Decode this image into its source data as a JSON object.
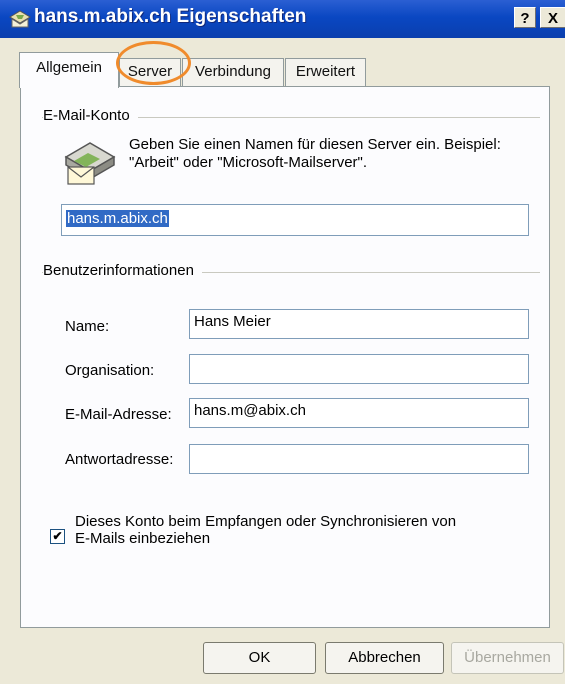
{
  "window": {
    "title": "hans.m.abix.ch Eigenschaften",
    "help_button": "?",
    "close_button": "X"
  },
  "tabs": [
    {
      "label": "Allgemein"
    },
    {
      "label": "Server"
    },
    {
      "label": "Verbindung"
    },
    {
      "label": "Erweitert"
    }
  ],
  "active_tab": "Allgemein",
  "account_section": {
    "label": "E-Mail-Konto",
    "hint_line1": "Geben Sie einen Namen für diesen Server ein. Beispiel:",
    "hint_line2": "\"Arbeit\" oder \"Microsoft-Mailserver\".",
    "account_name": "hans.m.abix.ch"
  },
  "user_section": {
    "label": "Benutzerinformationen",
    "name_label": "Name:",
    "name_value": "Hans Meier",
    "organisation_label": "Organisation:",
    "organisation_value": "",
    "email_label": "E-Mail-Adresse:",
    "email_value": "hans.m@abix.ch",
    "reply_label": "Antwortadresse:",
    "reply_value": ""
  },
  "sync": {
    "checked": true,
    "label_line1": "Dieses Konto beim Empfangen oder Synchronisieren von",
    "label_line2": "E-Mails einbeziehen"
  },
  "buttons": {
    "ok": "OK",
    "cancel": "Abbrechen",
    "apply": "Übernehmen"
  },
  "colors": {
    "titlebar": "#0a47c2",
    "highlight": "#f08b2c",
    "selection": "#316ac5"
  }
}
